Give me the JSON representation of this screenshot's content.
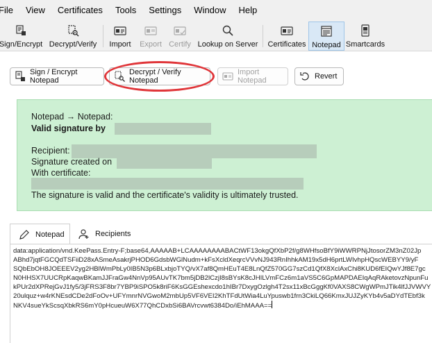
{
  "menubar": {
    "items": [
      "File",
      "View",
      "Certificates",
      "Tools",
      "Settings",
      "Window",
      "Help"
    ]
  },
  "toolbar": {
    "sign_encrypt": "Sign/Encrypt",
    "decrypt_verify": "Decrypt/Verify",
    "import": "Import",
    "export": "Export",
    "certify": "Certify",
    "lookup": "Lookup on Server",
    "certificates": "Certificates",
    "notepad": "Notepad",
    "smartcards": "Smartcards"
  },
  "actions": {
    "sign_encrypt_notepad": "Sign / Encrypt Notepad",
    "decrypt_verify_notepad": "Decrypt / Verify Notepad",
    "import_notepad": "Import Notepad",
    "revert": "Revert"
  },
  "result": {
    "header": "Notepad → Notepad:",
    "status": "Valid signature by",
    "recipient_label": "Recipient:",
    "created_label": "Signature created on",
    "certificate_label": "With certificate:",
    "trust_message": "The signature is valid and the certificate's validity is ultimately trusted.",
    "color": "#cdf0d3"
  },
  "tabs": [
    {
      "label": "Notepad",
      "icon": "pen-icon"
    },
    {
      "label": "Recipients",
      "icon": "add-person-icon"
    }
  ],
  "notepad": {
    "lines": [
      "data:application/vnd.KeePass.Entry-F;base64,AAAAAB+LCAAAAAAAABACtWF13okgQfXbP2f/g8WHfsoBfY9iWWRPNjJtosorZM3nZ02Jp",
      "ABhd7jqtFGCQdTSFiiD28xASmeAsakrjPHOD6GdsbWGlNudm+kFsXcldXeqrcVVvNJ943RnIhhkAM19x5dH6prtLWIvhpHQscWEBYY9/yF",
      "SQbEbOH8JOEEEV2yg2HBlWmPbLy0IB5N3p6BLxbjoTYQ/vX7af8QmHEuT4E8LnQfZ570GG7szCd1QfX8XclAxChi8KUD6fEIQwYJf8E7gc",
      "N0HHSX7UUCRpKaqwBKamJJFraGw4NnVp95AUvTK7bm5jDB2lCzjI8sBYsK8cJHILVmFCz6m1aVS5C6GpMAPDAEIqAqRAketovzNpunFu",
      "kPUr2dXPRejGvJ1fy5/3jFRS3F8br7YBP9iSPO5k8riF6KsGGEshexcdo1hIBr7DxygOzlgh4T2sx11xBcGggKf0VAXS8CWgWPmJTik4lfJJVWVY",
      "20ulquz+w4rKNEsdCDe2dFoOv+UFYmnrNVGwoM2mbUp5VF6VEI2KhTFdUtWia4LuYpuswb1frn3CkiLQ66KmxJUJZyKYb4v5aDYdTEbf3k",
      "NKV4sueYkScsqXbkRS6mY0pHcueuW6X77QhCDxbSi6BAVrcvwt6384Do/iEhMAAA=="
    ]
  }
}
